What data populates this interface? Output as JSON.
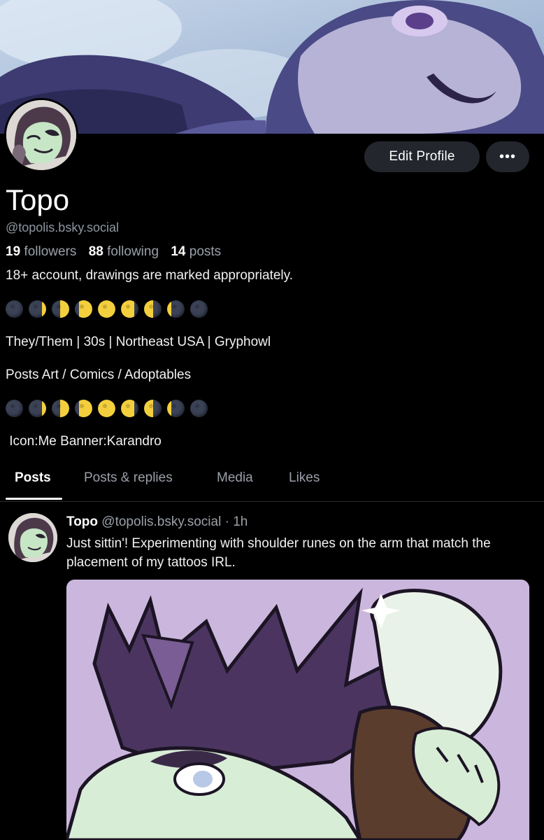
{
  "profile": {
    "name": "Topo",
    "handle": "@topolis.bsky.social",
    "followers_count": "19",
    "followers_label": "followers",
    "following_count": "88",
    "following_label": "following",
    "posts_count": "14",
    "posts_label": "posts",
    "bio_line1": "18+ account, drawings are marked appropriately.",
    "bio_line2": "They/Them | 30s | Northeast USA | Gryphowl",
    "bio_line3": "Posts Art / Comics / Adoptables",
    "bio_line4": " Icon:Me Banner:Karandro",
    "moon_sequence": [
      "🌑",
      "🌒",
      "🌓",
      "🌔",
      "🌕",
      "🌖",
      "🌗",
      "🌘",
      "🌑"
    ]
  },
  "actions": {
    "edit_label": "Edit Profile",
    "more_label": "•••"
  },
  "tabs": [
    {
      "label": "Posts",
      "active": true
    },
    {
      "label": "Posts & replies",
      "active": false
    },
    {
      "label": "Media",
      "active": false
    },
    {
      "label": "Likes",
      "active": false
    }
  ],
  "post": {
    "author": "Topo",
    "handle": "@topolis.bsky.social",
    "separator": "·",
    "time": "1h",
    "text": "Just sittin'! Experimenting with shoulder runes on the arm that match the placement of my tattoos IRL."
  },
  "colors": {
    "background": "#000000",
    "button_bg": "#23262d",
    "muted_text": "#9aa0a8",
    "moon_lit": "#f4cf3d",
    "moon_dark": "#3b4256",
    "image_bg": "#cbb7dd"
  }
}
